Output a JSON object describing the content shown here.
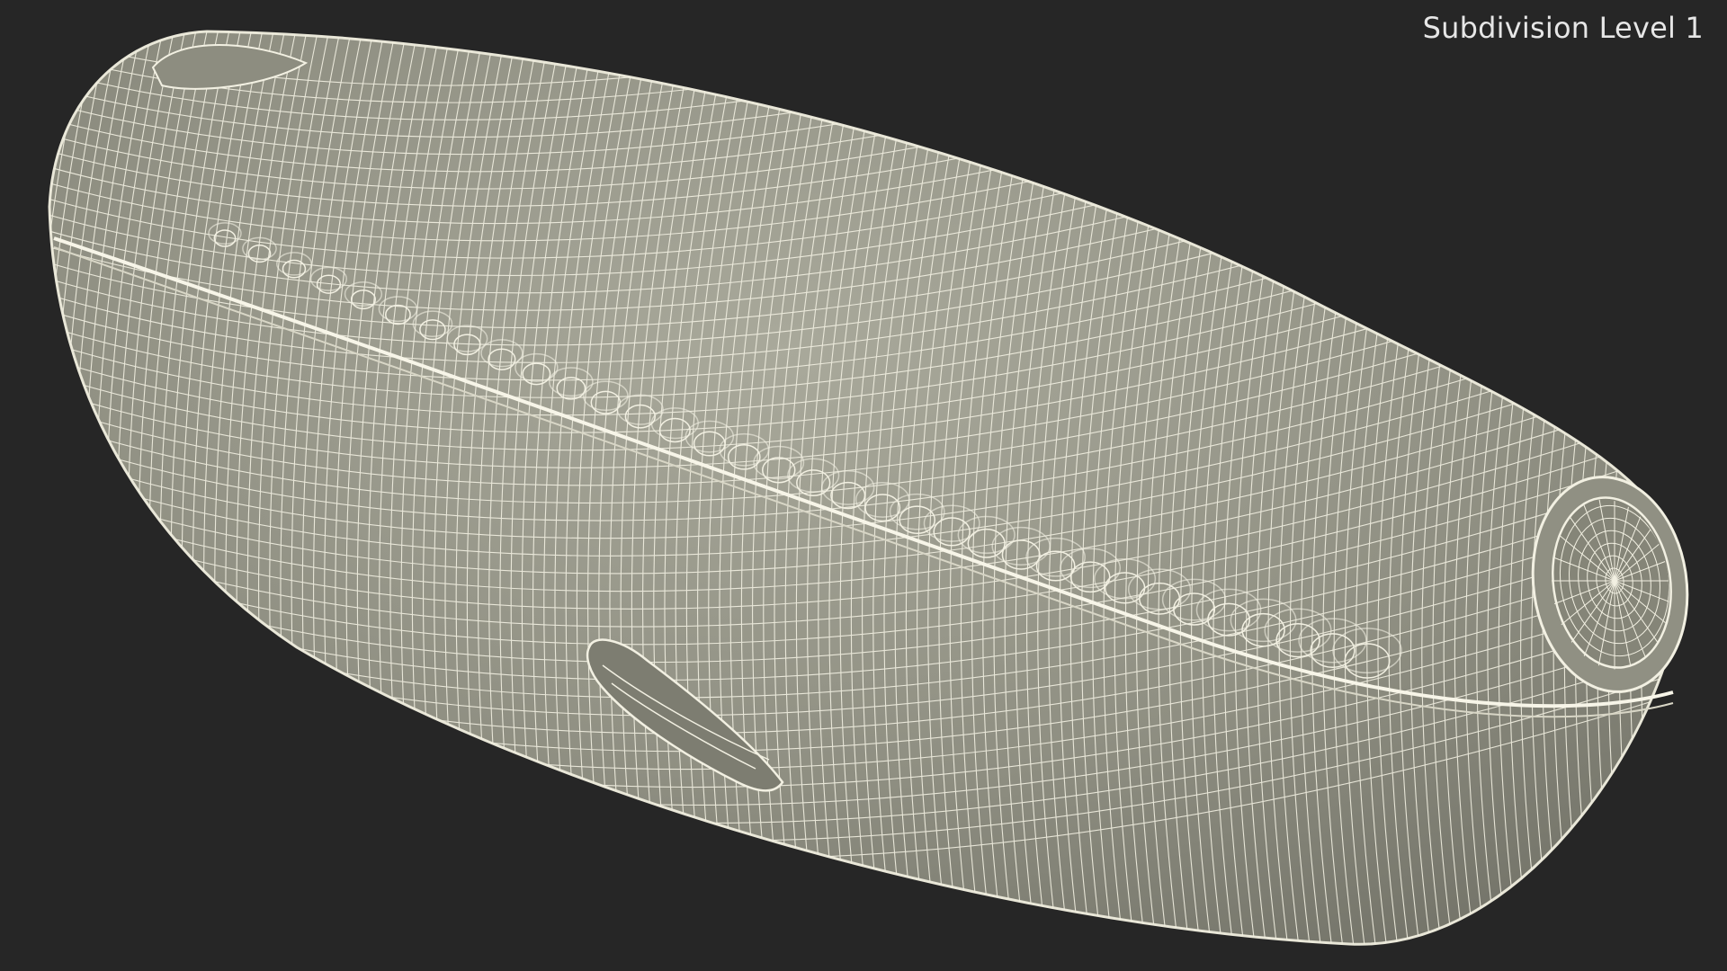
{
  "caption": {
    "label": "Subdivision Level 1"
  },
  "colors": {
    "background": "#262626",
    "mesh_surface": "#8a8a7d",
    "wireframe": "#f2f0e2",
    "caption_text": "#e6e6e6"
  },
  "model": {
    "shading": "wireframe-over-shaded"
  }
}
